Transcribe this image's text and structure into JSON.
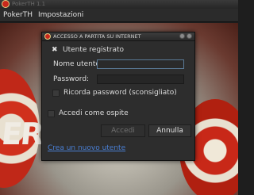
{
  "app": {
    "title": "PokerTH 1.1",
    "menu": [
      {
        "label": "PokerTH"
      },
      {
        "label": "Impostazioni"
      }
    ]
  },
  "dialog": {
    "title": "ACCESSO A PARTITA SU INTERNET",
    "registered_label": "Utente registrato",
    "username_label": "Nome utente:",
    "username_value": "",
    "password_label": "Password:",
    "password_value": "",
    "remember_label": "Ricorda password (sconsigliato)",
    "guest_label": "Accedi come ospite",
    "login_button": "Accedi",
    "cancel_button": "Annulla",
    "create_link": "Crea un nuovo utente"
  },
  "background": {
    "text": "ER"
  }
}
